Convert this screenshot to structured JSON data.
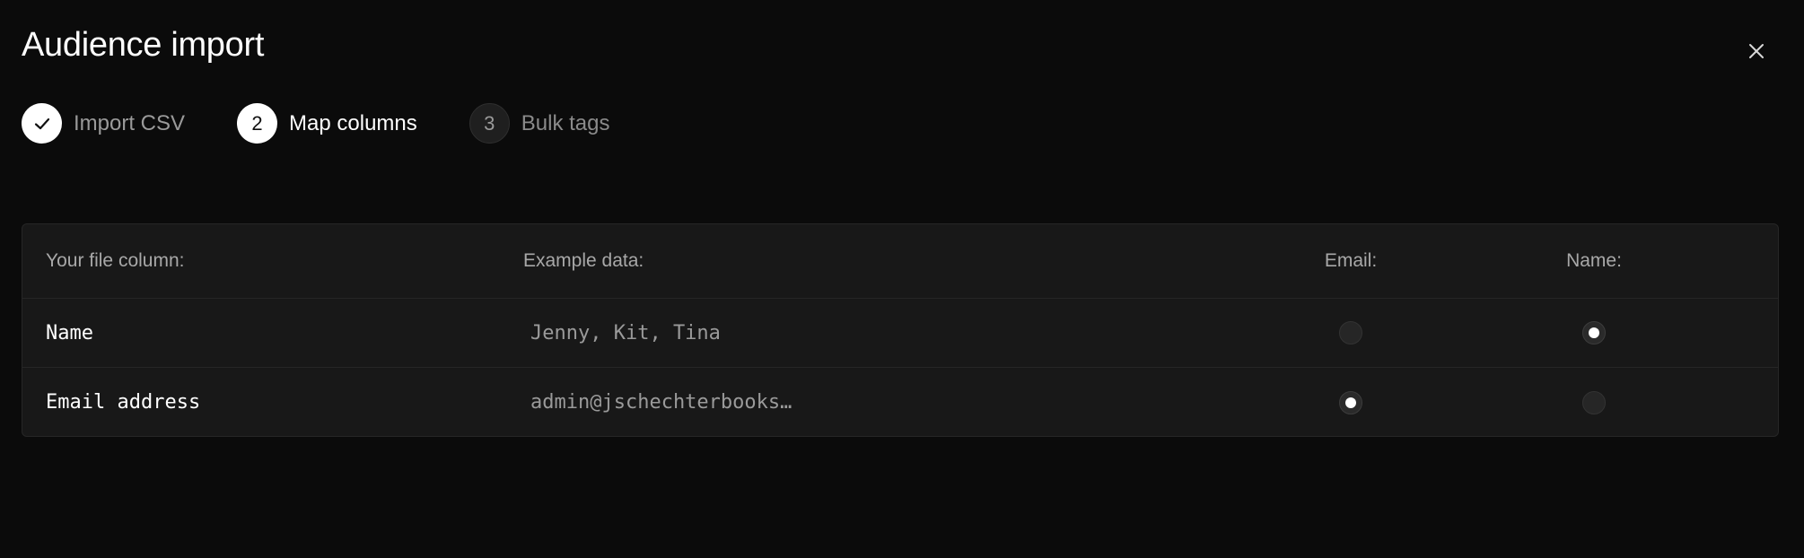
{
  "dialog": {
    "title": "Audience import",
    "close_icon": "close-icon"
  },
  "steps": [
    {
      "number": "1",
      "label": "Import CSV",
      "state": "completed",
      "icon": "check-icon"
    },
    {
      "number": "2",
      "label": "Map columns",
      "state": "active"
    },
    {
      "number": "3",
      "label": "Bulk tags",
      "state": "pending"
    }
  ],
  "table": {
    "headers": {
      "file_column": "Your file column:",
      "example_data": "Example data:",
      "email": "Email:",
      "name": "Name:"
    },
    "rows": [
      {
        "file_column": "Name",
        "example": "Jenny, Kit, Tina",
        "email_selected": false,
        "name_selected": true
      },
      {
        "file_column": "Email address",
        "example": "admin@jschechterbooks…",
        "email_selected": true,
        "name_selected": false
      }
    ]
  },
  "colors": {
    "background": "#0b0b0b",
    "panel": "#181818",
    "border": "#262626",
    "text_primary": "#ffffff",
    "text_muted": "#9a9a9a"
  }
}
